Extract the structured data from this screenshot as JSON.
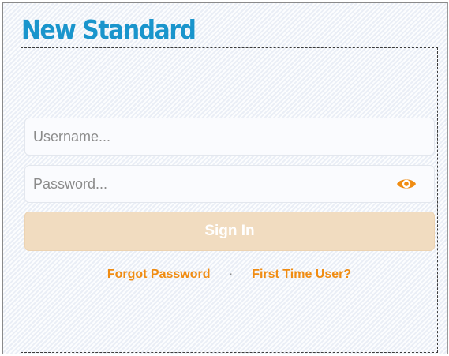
{
  "app": {
    "title": "New Standard"
  },
  "login": {
    "username_placeholder": "Username...",
    "password_placeholder": "Password...",
    "signin_label": "Sign In",
    "forgot_password_label": "Forgot Password",
    "separator": "·",
    "first_time_user_label": "First Time User?"
  },
  "icons": {
    "show_password": "eye-icon"
  },
  "colors": {
    "title": "#1a95cc",
    "accent": "#f08c12",
    "signin_background": "#f1dcc0"
  }
}
